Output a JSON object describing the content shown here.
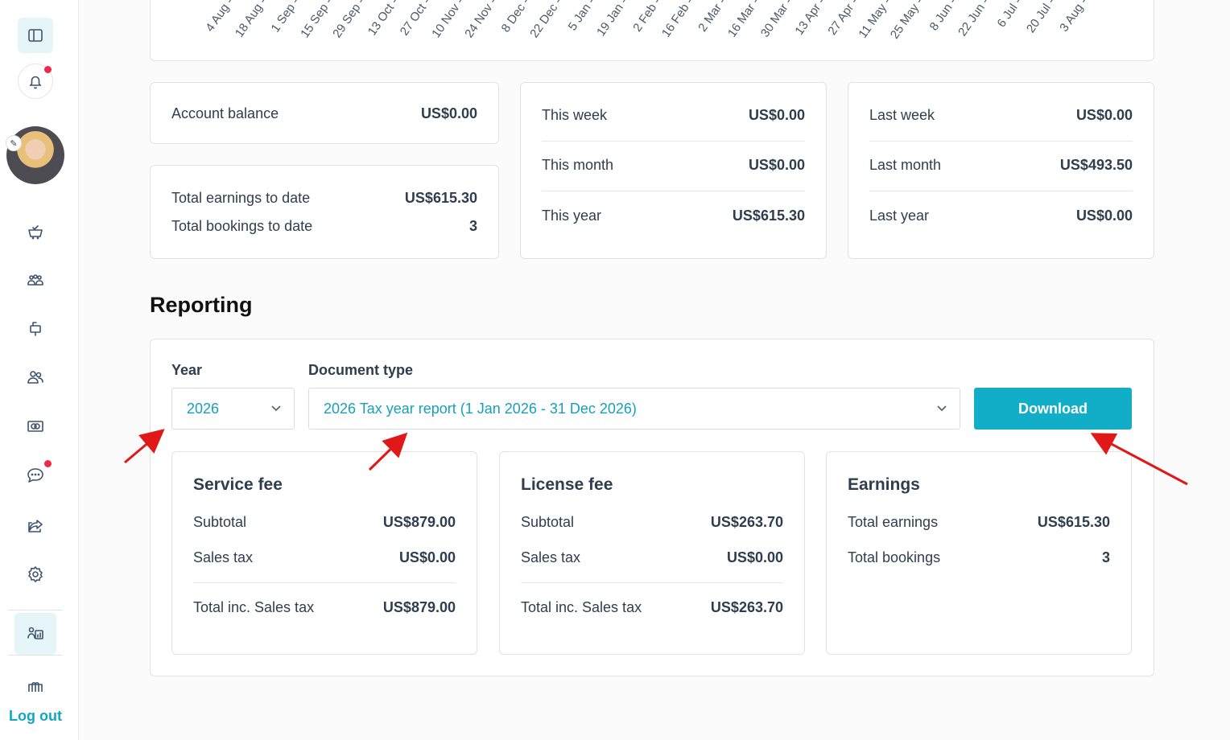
{
  "chart_data": {
    "type": "bar",
    "categories": [
      "4 Aug",
      "18 Aug",
      "1 Sep",
      "15 Sep",
      "29 Sep",
      "13 Oct",
      "27 Oct",
      "10 Nov",
      "24 Nov",
      "8 Dec",
      "22 Dec",
      "5 Jan",
      "19 Jan",
      "2 Feb",
      "16 Feb",
      "2 Mar",
      "16 Mar",
      "30 Mar",
      "13 Apr",
      "27 Apr",
      "11 May",
      "25 May",
      "8 Jun",
      "22 Jun",
      "6 Jul",
      "20 Jul",
      "3 Aug"
    ],
    "tick_suffix": " -"
  },
  "sidebar": {
    "toggle_icon": "sidebar-toggle-icon",
    "items": [
      {
        "icon": "basket-icon"
      },
      {
        "icon": "group-icon"
      },
      {
        "icon": "mailbox-icon"
      },
      {
        "icon": "users-icon"
      },
      {
        "icon": "banknote-icon"
      },
      {
        "icon": "chat-icon"
      },
      {
        "icon": "share-icon"
      },
      {
        "icon": "settings-icon"
      },
      {
        "icon": "dashboard-icon"
      },
      {
        "icon": "gift-icon"
      }
    ],
    "logout_label": "Log out"
  },
  "summary": {
    "account_balance": {
      "label": "Account balance",
      "value": "US$0.00"
    },
    "totals": [
      {
        "label": "Total earnings to date",
        "value": "US$615.30"
      },
      {
        "label": "Total bookings to date",
        "value": "3"
      }
    ],
    "current": [
      {
        "label": "This week",
        "value": "US$0.00"
      },
      {
        "label": "This month",
        "value": "US$0.00"
      },
      {
        "label": "This year",
        "value": "US$615.30"
      }
    ],
    "previous": [
      {
        "label": "Last week",
        "value": "US$0.00"
      },
      {
        "label": "Last month",
        "value": "US$493.50"
      },
      {
        "label": "Last year",
        "value": "US$0.00"
      }
    ]
  },
  "reporting": {
    "title": "Reporting",
    "year_label": "Year",
    "year_value": "2026",
    "doc_type_label": "Document type",
    "doc_type_value": "2026 Tax year report (1 Jan 2026 - 31 Dec 2026)",
    "download_label": "Download",
    "service_fee": {
      "title": "Service fee",
      "subtotal_label": "Subtotal",
      "subtotal": "US$879.00",
      "tax_label": "Sales tax",
      "tax": "US$0.00",
      "total_label": "Total inc. Sales tax",
      "total": "US$879.00"
    },
    "license_fee": {
      "title": "License fee",
      "subtotal_label": "Subtotal",
      "subtotal": "US$263.70",
      "tax_label": "Sales tax",
      "tax": "US$0.00",
      "total_label": "Total inc. Sales tax",
      "total": "US$263.70"
    },
    "earnings": {
      "title": "Earnings",
      "total_earnings_label": "Total earnings",
      "total_earnings": "US$615.30",
      "total_bookings_label": "Total bookings",
      "total_bookings": "3"
    }
  },
  "colors": {
    "accent": "#12aec8",
    "annotation": "#e01818",
    "notification": "#f0284a"
  }
}
